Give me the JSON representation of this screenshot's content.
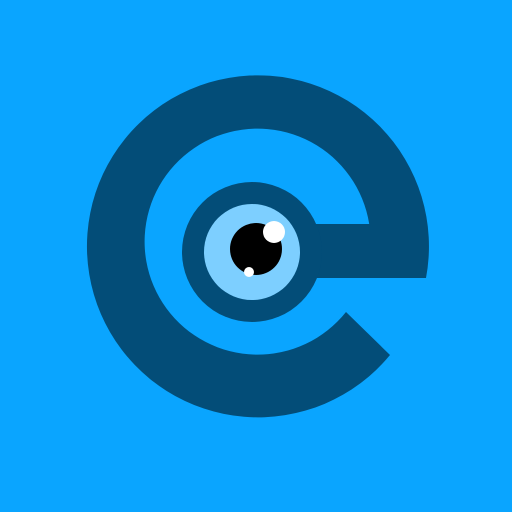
{
  "icon": {
    "name": "e-letter-eye-logo",
    "colors": {
      "background": "#0aa5ff",
      "letter": "#034d78",
      "iris_ring": "#034d78",
      "iris": "#7dcfff",
      "pupil": "#000000",
      "highlight": "#ffffff"
    }
  }
}
